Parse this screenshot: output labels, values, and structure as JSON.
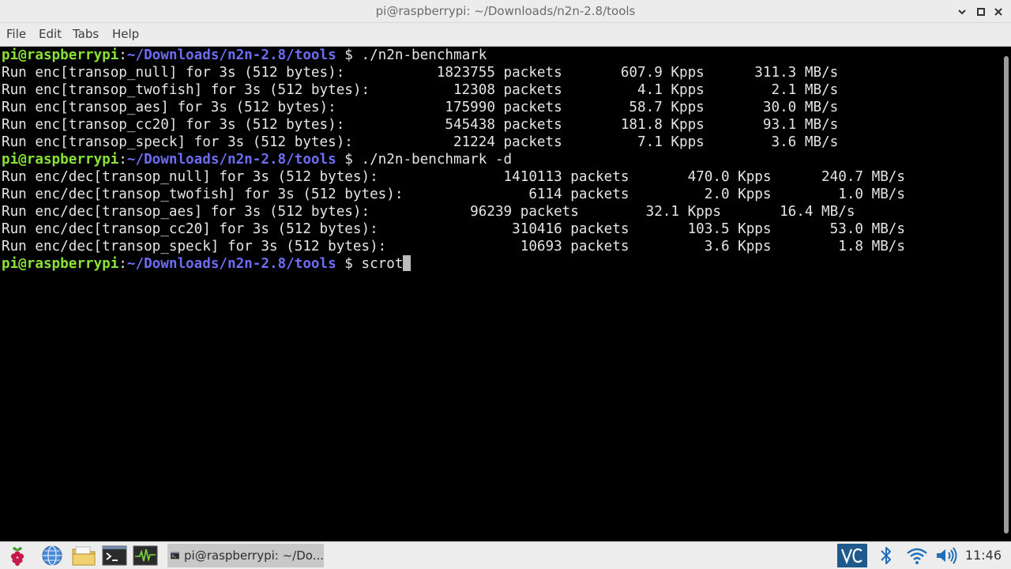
{
  "window": {
    "title": "pi@raspberrypi: ~/Downloads/n2n-2.8/tools"
  },
  "menu": [
    {
      "label": "File"
    },
    {
      "label": "Edit"
    },
    {
      "label": "Tabs"
    },
    {
      "label": "Help"
    }
  ],
  "terminal": {
    "prompt_user": "pi@raspberrypi",
    "prompt_colon": ":",
    "prompt_path": "~/Downloads/n2n-2.8/tools",
    "prompt_symbol": " $ ",
    "lines": [
      {
        "kind": "prompt",
        "command": "./n2n-benchmark"
      },
      {
        "kind": "out",
        "text": "Run enc[transop_null] for 3s (512 bytes):           1823755 packets       607.9 Kpps      311.3 MB/s"
      },
      {
        "kind": "out",
        "text": "Run enc[transop_twofish] for 3s (512 bytes):          12308 packets         4.1 Kpps        2.1 MB/s"
      },
      {
        "kind": "out",
        "text": "Run enc[transop_aes] for 3s (512 bytes):             175990 packets        58.7 Kpps       30.0 MB/s"
      },
      {
        "kind": "out",
        "text": "Run enc[transop_cc20] for 3s (512 bytes):            545438 packets       181.8 Kpps       93.1 MB/s"
      },
      {
        "kind": "out",
        "text": "Run enc[transop_speck] for 3s (512 bytes):            21224 packets         7.1 Kpps        3.6 MB/s"
      },
      {
        "kind": "prompt",
        "command": "./n2n-benchmark -d"
      },
      {
        "kind": "out",
        "text": "Run enc/dec[transop_null] for 3s (512 bytes):               1410113 packets       470.0 Kpps      240.7 MB/s"
      },
      {
        "kind": "out",
        "text": "Run enc/dec[transop_twofish] for 3s (512 bytes):               6114 packets         2.0 Kpps        1.0 MB/s"
      },
      {
        "kind": "out",
        "text": "Run enc/dec[transop_aes] for 3s (512 bytes):            96239 packets        32.1 Kpps       16.4 MB/s"
      },
      {
        "kind": "out",
        "text": "Run enc/dec[transop_cc20] for 3s (512 bytes):                310416 packets       103.5 Kpps       53.0 MB/s"
      },
      {
        "kind": "out",
        "text": "Run enc/dec[transop_speck] for 3s (512 bytes):                10693 packets         3.6 Kpps        1.8 MB/s"
      },
      {
        "kind": "prompt",
        "command": "scrot",
        "cursor": true
      }
    ]
  },
  "taskbar": {
    "launchers": [
      {
        "icon": "raspberry-menu-icon"
      },
      {
        "icon": "web-browser-icon"
      },
      {
        "icon": "file-manager-icon"
      },
      {
        "icon": "terminal-icon"
      },
      {
        "icon": "system-monitor-icon"
      }
    ],
    "task_label": "pi@raspberrypi: ~/Do...",
    "tray": [
      {
        "icon": "vnc-icon"
      },
      {
        "icon": "bluetooth-icon"
      },
      {
        "icon": "wifi-icon"
      },
      {
        "icon": "volume-icon"
      }
    ],
    "clock": "11:46"
  },
  "colors": {
    "prompt_user": "#8ae234",
    "prompt_path": "#6d6cf4",
    "terminal_bg": "#000000",
    "terminal_fg": "#e5e5e5"
  }
}
